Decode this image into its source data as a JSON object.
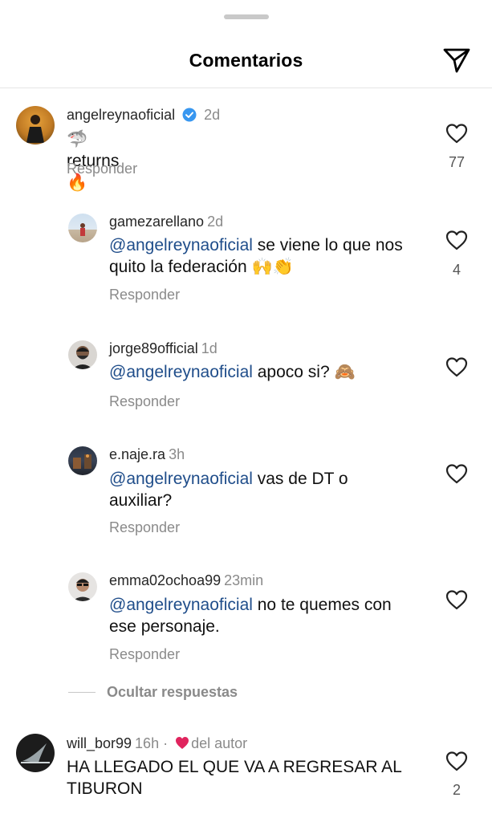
{
  "header": {
    "title": "Comentarios",
    "share_icon": "send-paper-plane-icon"
  },
  "colors": {
    "mention": "#1f4d8a",
    "muted": "#8a8a8a",
    "heart": "#e0245e",
    "verified": "#3897f0"
  },
  "comments": [
    {
      "username": "angelreynaoficial",
      "verified": true,
      "time": "2d",
      "emoji_prefix": "🦈",
      "text": "returns",
      "emoji_suffix": "🔥",
      "reply_label": "Responder",
      "likes": "77"
    },
    {
      "username": "gamezarellano",
      "time": "2d",
      "mention": "@angelreynaoficial",
      "text_line1": " se viene lo que nos",
      "text_line2": "quito la federación ",
      "emoji": "🙌👏",
      "reply_label": "Responder",
      "likes": "4"
    },
    {
      "username": "jorge89official",
      "time": "1d",
      "mention": "@angelreynaoficial",
      "text": " apoco si? ",
      "emoji": "🙈",
      "reply_label": "Responder"
    },
    {
      "username": "e.naje.ra",
      "time": "3h",
      "mention": "@angelreynaoficial",
      "text_line1": " vas de DT o",
      "text_line2": "auxiliar?",
      "reply_label": "Responder"
    },
    {
      "username": "emma02ochoa99",
      "time": "23min",
      "mention": "@angelreynaoficial",
      "text_line1": " no te quemes con",
      "text_line2": "ese personaje.",
      "reply_label": "Responder"
    },
    {
      "username": "will_bor99",
      "time": "16h ·",
      "author_badge": "del autor",
      "text_line1": "HA LLEGADO EL QUE VA A REGRESAR AL",
      "text_line2": "TIBURON",
      "likes": "2"
    }
  ],
  "hide_replies": "Ocultar respuestas"
}
